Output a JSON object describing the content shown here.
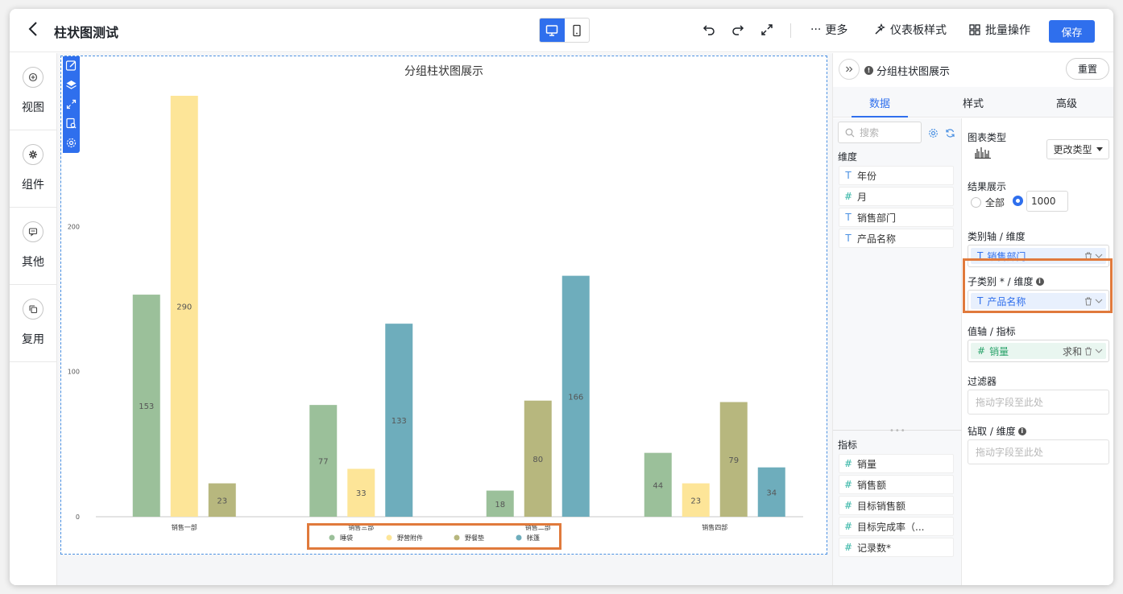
{
  "header": {
    "title": "柱状图测试",
    "more_label": "更多",
    "theme_label": "仪表板样式",
    "batch_label": "批量操作",
    "save_label": "保存"
  },
  "leftnav": [
    {
      "label": "视图",
      "icon": "plus-circle-icon"
    },
    {
      "label": "组件",
      "icon": "gear-icon"
    },
    {
      "label": "其他",
      "icon": "message-icon"
    },
    {
      "label": "复用",
      "icon": "copy-icon"
    }
  ],
  "chart_data": {
    "type": "bar",
    "title": "分组柱状图展示",
    "categories": [
      "销售一部",
      "销售三部",
      "销售二部",
      "销售四部"
    ],
    "yticks": [
      0,
      100,
      200
    ],
    "ylim": [
      0,
      290
    ],
    "series": [
      {
        "name": "睡袋",
        "color": "#9bc09a",
        "values": [
          153,
          77,
          18,
          44
        ]
      },
      {
        "name": "野营附件",
        "color": "#fde598",
        "values": [
          290,
          33,
          null,
          23
        ]
      },
      {
        "name": "野餐垫",
        "color": "#b7b77e",
        "values": [
          23,
          null,
          80,
          79
        ]
      },
      {
        "name": "帐篷",
        "color": "#6eadbc",
        "values": [
          null,
          133,
          166,
          34
        ]
      }
    ],
    "legend_position": "bottom",
    "grid": false
  },
  "panel": {
    "chart_name": "分组柱状图展示",
    "reset_label": "重置",
    "tabs": [
      "数据",
      "样式",
      "高级"
    ],
    "search_placeholder": "搜索",
    "dimension_label": "维度",
    "dimensions": [
      {
        "type": "T",
        "name": "年份"
      },
      {
        "type": "#",
        "name": "月"
      },
      {
        "type": "T",
        "name": "销售部门"
      },
      {
        "type": "T",
        "name": "产品名称"
      }
    ],
    "metric_label": "指标",
    "metrics": [
      {
        "type": "#",
        "name": "销量"
      },
      {
        "type": "#",
        "name": "销售额"
      },
      {
        "type": "#",
        "name": "目标销售额"
      },
      {
        "type": "#",
        "name": "目标完成率（..."
      },
      {
        "type": "#",
        "name": "记录数*"
      }
    ],
    "chart_type_label": "图表类型",
    "change_type_label": "更改类型",
    "result_label": "结果展示",
    "result_all": "全部",
    "result_limit": "1000",
    "category_axis_label": "类别轴 / 维度",
    "category_axis_field": "销售部门",
    "subcategory_label": "子类别 * / 维度",
    "subcategory_field": "产品名称",
    "value_axis_label": "值轴 / 指标",
    "value_axis_field": "销量",
    "value_axis_agg": "求和",
    "filter_label": "过滤器",
    "filter_placeholder": "拖动字段至此处",
    "drill_label": "钻取 / 维度",
    "drill_placeholder": "拖动字段至此处"
  }
}
